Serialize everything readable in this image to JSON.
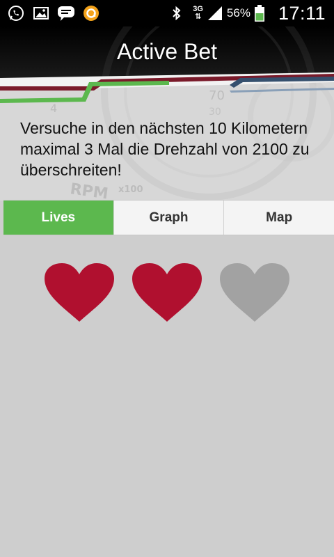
{
  "status_bar": {
    "network": "3G",
    "battery_percent": "56%",
    "clock": "17:11",
    "icons": [
      "whatsapp-icon",
      "gallery-icon",
      "chat-icon",
      "app-notification-icon",
      "bluetooth-icon",
      "signal-icon",
      "battery-icon"
    ]
  },
  "header": {
    "title": "Active Bet"
  },
  "bet": {
    "description": "Versuche in den nächsten 10 Kilometern maximal 3 Mal die Drehzahl von 2100 zu überschreiten!"
  },
  "tabs": [
    {
      "label": "Lives",
      "active": true
    },
    {
      "label": "Graph",
      "active": false
    },
    {
      "label": "Map",
      "active": false
    }
  ],
  "lives": {
    "total": 3,
    "remaining": 2,
    "colors": {
      "full": "#b0102f",
      "lost": "#a2a2a2"
    }
  },
  "colors": {
    "accent_green": "#5cb84e",
    "background": "#cecece"
  }
}
